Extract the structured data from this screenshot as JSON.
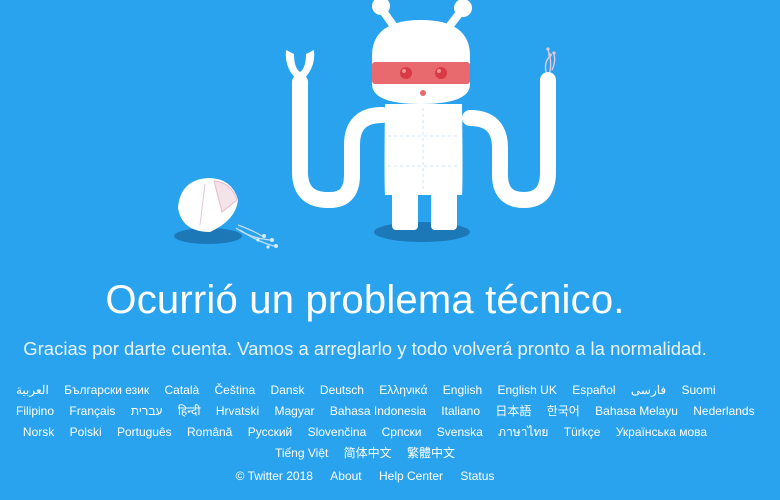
{
  "error": {
    "title": "Ocurrió un problema técnico.",
    "message": "Gracias por darte cuenta. Vamos a arreglarlo y todo volverá pronto a la normalidad."
  },
  "languages": [
    [
      "العربية",
      "Български език",
      "Català",
      "Čeština",
      "Dansk",
      "Deutsch",
      "Ελληνικά",
      "English",
      "English UK",
      "Español",
      "فارسی",
      "Suomi"
    ],
    [
      "Filipino",
      "Français",
      "עברית",
      "हिन्दी",
      "Hrvatski",
      "Magyar",
      "Bahasa Indonesia",
      "Italiano",
      "日本語",
      "한국어",
      "Bahasa Melayu",
      "Nederlands"
    ],
    [
      "Norsk",
      "Polski",
      "Português",
      "Română",
      "Русский",
      "Slovenčina",
      "Српски",
      "Svenska",
      "ภาษาไทย",
      "Türkçe",
      "Українська мова"
    ],
    [
      "Tiếng Việt",
      "简体中文",
      "繁體中文"
    ]
  ],
  "footer": {
    "copyright": "© Twitter 2018",
    "links": [
      "About",
      "Help Center",
      "Status"
    ]
  },
  "colors": {
    "background": "#2AA3EF",
    "robot_body": "#FFFFFF",
    "robot_visor": "#E8696E",
    "shadow": "#1D78B8"
  },
  "illustration": {
    "icons": [
      "broken-robot-icon",
      "robot-head-fragment-icon"
    ]
  }
}
